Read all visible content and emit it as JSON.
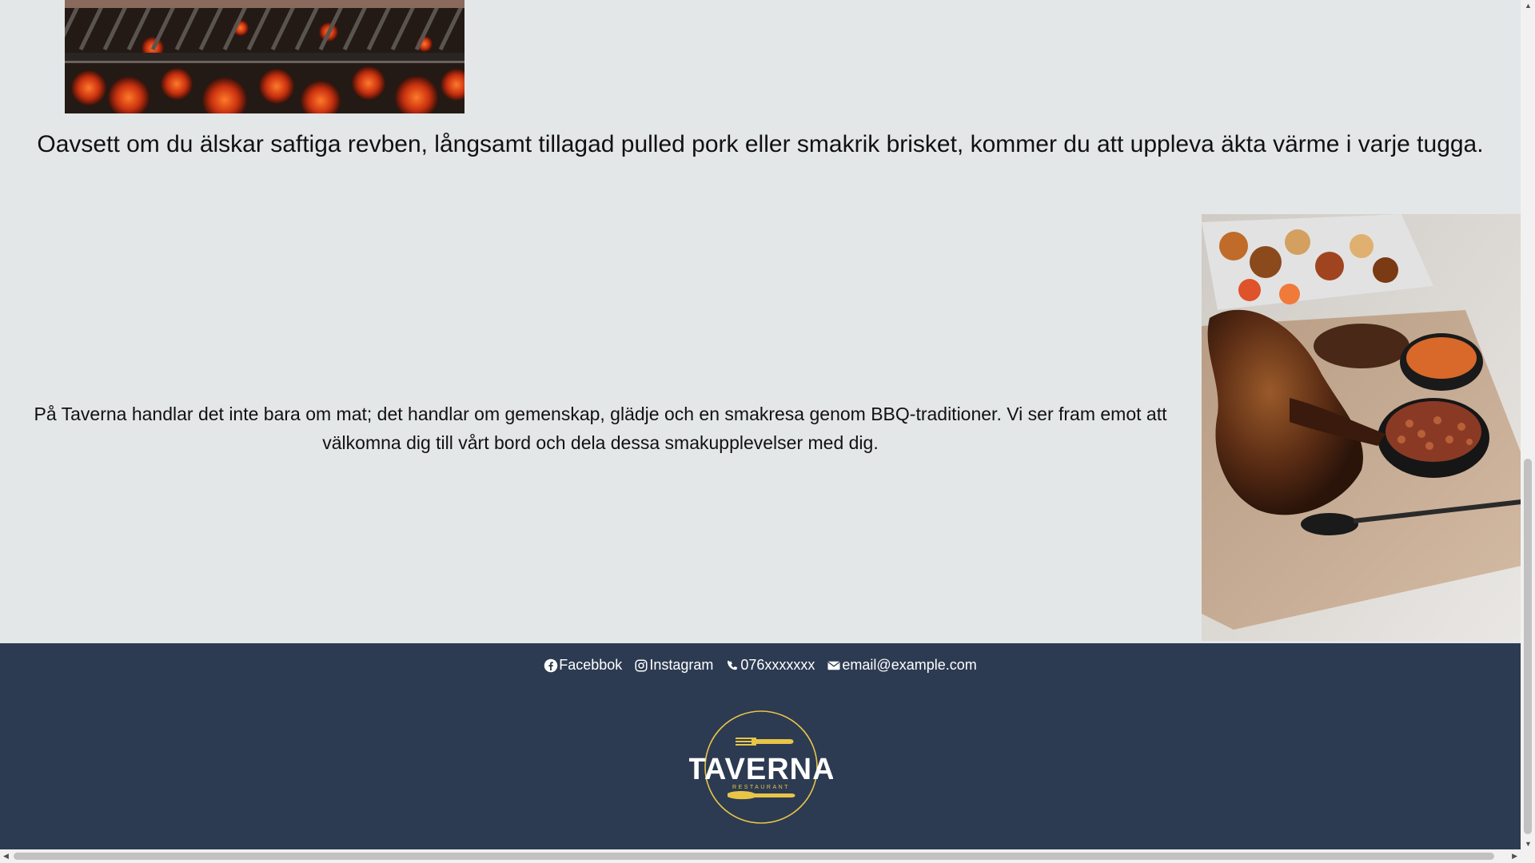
{
  "intro": {
    "text": "Oavsett om du älskar saftiga revben, långsamt tillagad pulled pork eller smakrik brisket, kommer du att uppleva äkta värme i varje tugga."
  },
  "about": {
    "text": "På Taverna handlar det inte bara om mat; det handlar om gemenskap, glädje och en smakresa genom BBQ-traditioner. Vi ser fram emot att välkomna dig till vårt bord och dela dessa smakupplevelser med dig."
  },
  "footer": {
    "contacts": [
      {
        "icon": "facebook-icon",
        "label": "Facebbok"
      },
      {
        "icon": "instagram-icon",
        "label": "Instagram"
      },
      {
        "icon": "phone-icon",
        "label": "076xxxxxxx"
      },
      {
        "icon": "envelope-icon",
        "label": "email@example.com"
      }
    ],
    "logo": {
      "name": "TAVERNA",
      "subtitle": "RESTAURANT"
    }
  },
  "colors": {
    "page_bg": "#e4e7e8",
    "footer_bg": "#2c3b52",
    "logo_accent": "#e8c547"
  }
}
